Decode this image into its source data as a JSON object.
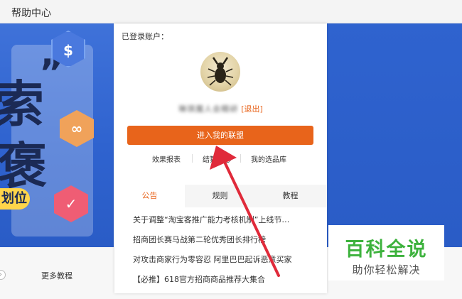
{
  "topbar": {
    "title": "帮助中心"
  },
  "banner": {
    "char1": "索",
    "char2": "褒",
    "quote": "”",
    "pill_text": "划位"
  },
  "account": {
    "logged_in_label": "已登录账户：",
    "username": "琳琪魔人会精研",
    "logout_label": "[退出]",
    "enter_button": "进入我的联盟"
  },
  "quick_links": [
    "效果报表",
    "结算中心",
    "我的选品库"
  ],
  "tabs": [
    "公告",
    "规则",
    "教程"
  ],
  "news": [
    "关于调整“淘宝客推广能力考核机制”上线节…",
    "招商团长赛马战第二轮优秀团长排行榜",
    "对攻击商家行为零容忍 阿里巴巴起诉恶意买家",
    "【必推】618官方招商商品推荐大集合"
  ],
  "bottom": {
    "more_tutorial": "更多教程"
  },
  "watermark": {
    "title": "百科全说",
    "subtitle": "助你轻松解决"
  },
  "colors": {
    "accent": "#e8641b",
    "banner_blue": "#2f63cf",
    "watermark_green": "#3db23d"
  },
  "icons": [
    "dollar-icon",
    "link-icon",
    "check-icon",
    "arrow-annotation-icon"
  ]
}
